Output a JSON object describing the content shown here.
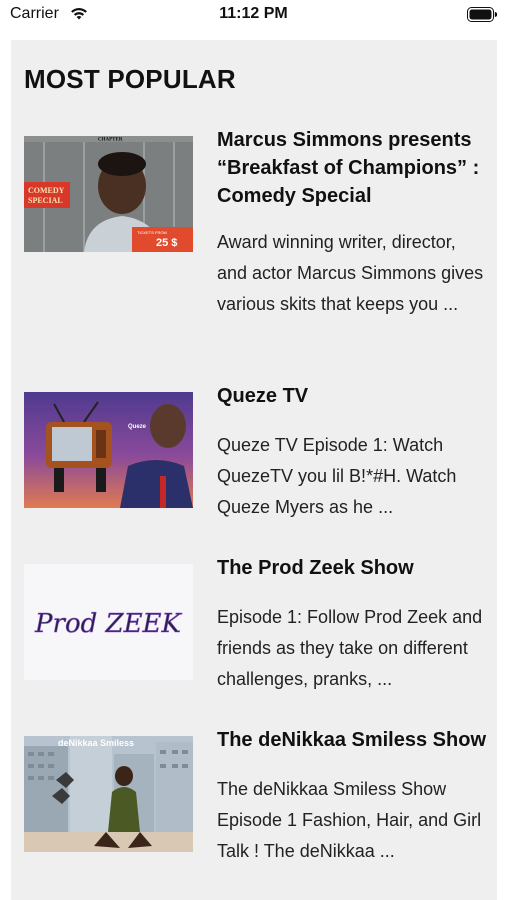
{
  "status_bar": {
    "carrier": "Carrier",
    "time": "11:12 PM",
    "wifi_icon": "wifi-icon",
    "battery_icon": "battery-icon"
  },
  "section": {
    "title": "MOST POPULAR"
  },
  "items": [
    {
      "title": "Marcus Simmons presents “Breakfast of Champions” : Comedy Special",
      "description": "Award winning writer, director, and actor Marcus Simmons gives various skits that keeps you ...",
      "thumbnail": {
        "header": "CHAPTER",
        "badge_line1": "COMEDY",
        "badge_line2": "SPECIAL",
        "price": "25 $",
        "label": "TICKETS FROM"
      }
    },
    {
      "title": "Queze TV",
      "description": " Queze TV Episode 1: Watch QuezeTV you lil B!*#H. Watch Queze Myers as he ...",
      "thumbnail": {
        "label": "Queze"
      }
    },
    {
      "title": "The Prod Zeek Show",
      "description": "Episode 1: Follow Prod Zeek and friends as they take on different challenges, pranks, ...",
      "thumbnail": {
        "logo_text": "Prod ZEEK"
      }
    },
    {
      "title": "The deNikkaa Smiless Show",
      "description": "The deNikkaa Smiless Show Episode 1 Fashion, Hair, and Girl Talk ! The deNikkaa ...",
      "thumbnail": {
        "label": "deNikkaa Smiless"
      }
    }
  ]
}
